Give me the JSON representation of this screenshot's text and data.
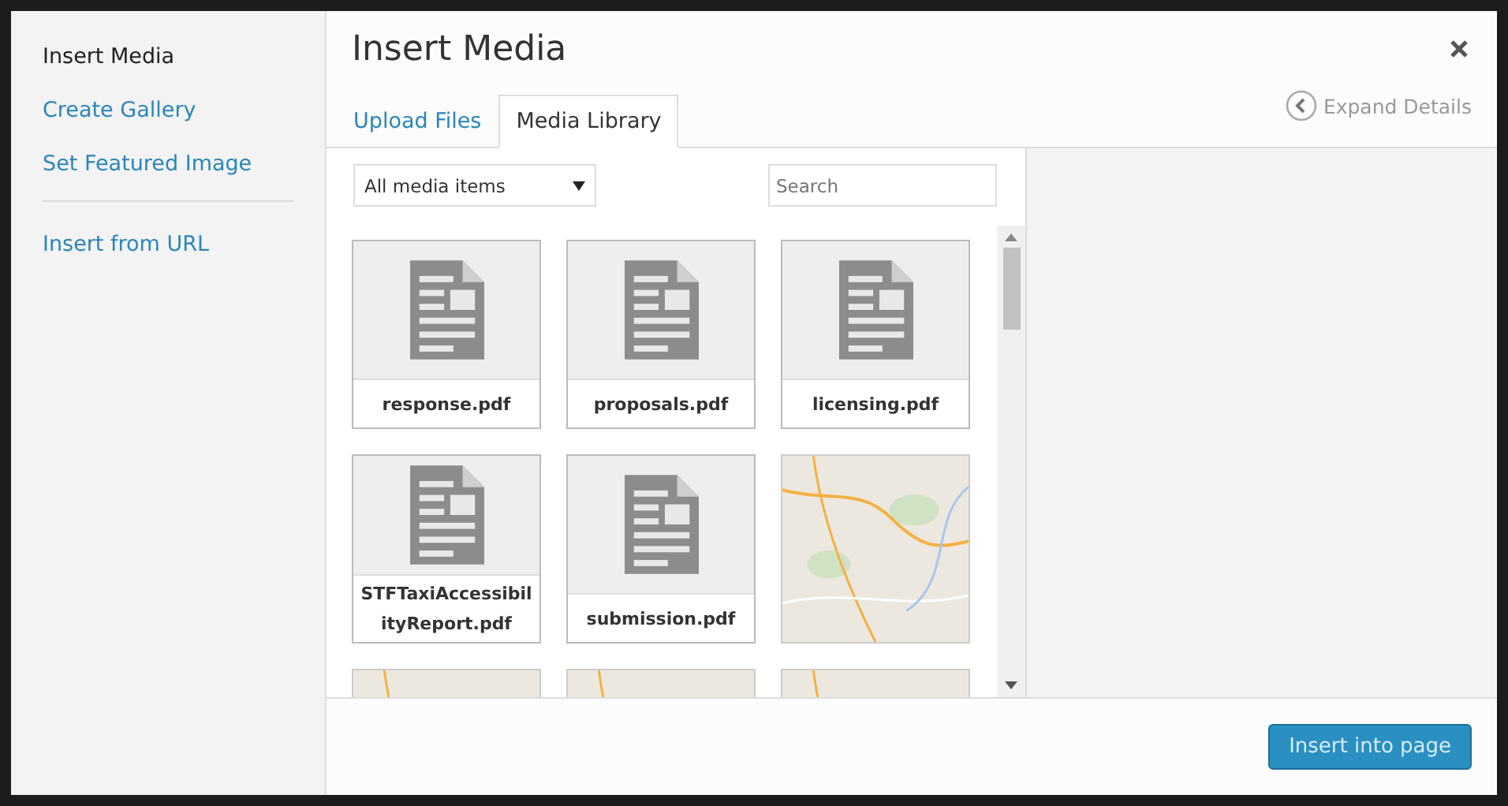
{
  "sidebar": {
    "groups": [
      {
        "items": [
          {
            "label": "Insert Media",
            "selected": true
          },
          {
            "label": "Create Gallery",
            "selected": false
          },
          {
            "label": "Set Featured Image",
            "selected": false
          }
        ]
      },
      {
        "items": [
          {
            "label": "Insert from URL",
            "selected": false
          }
        ]
      }
    ]
  },
  "modal": {
    "title": "Insert Media"
  },
  "tabs": [
    {
      "label": "Upload Files",
      "selected": false
    },
    {
      "label": "Media Library",
      "selected": true
    }
  ],
  "expand_details": "Expand Details",
  "filter": {
    "value": "All media items"
  },
  "search": {
    "placeholder": "Search"
  },
  "attachments": [
    {
      "kind": "document",
      "filename": "response.pdf"
    },
    {
      "kind": "document",
      "filename": "proposals.pdf"
    },
    {
      "kind": "document",
      "filename": "licensing.pdf"
    },
    {
      "kind": "document",
      "filename": "STFTaxiAccessibilityReport.pdf"
    },
    {
      "kind": "document",
      "filename": "submission.pdf"
    },
    {
      "kind": "map"
    },
    {
      "kind": "map"
    },
    {
      "kind": "map"
    },
    {
      "kind": "map"
    }
  ],
  "primary_button": "Insert into page"
}
